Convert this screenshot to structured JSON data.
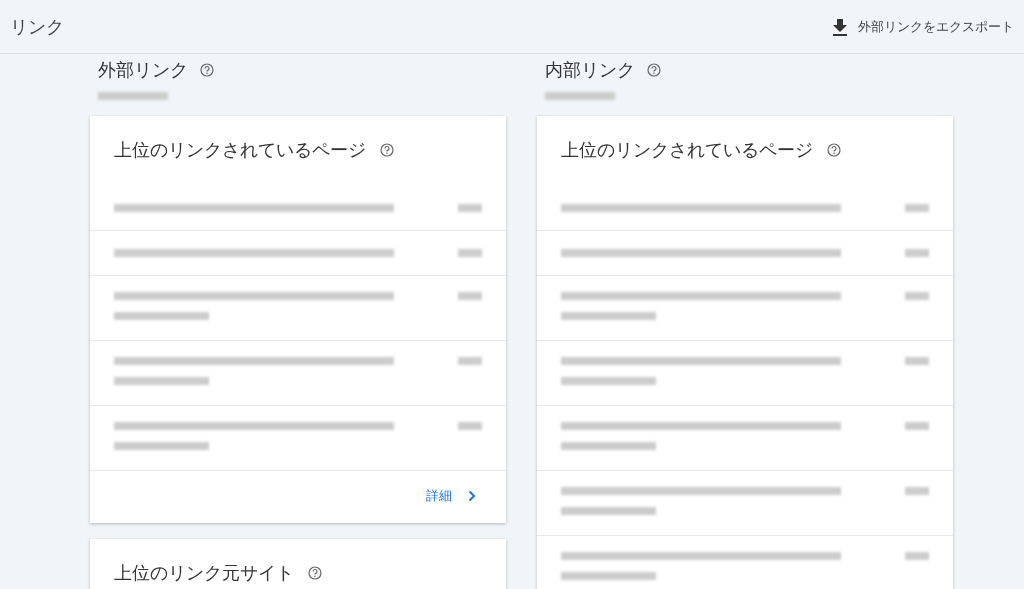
{
  "header": {
    "title": "リンク",
    "export_button": "外部リンクをエクスポート"
  },
  "columns": [
    {
      "title": "外部リンク",
      "cards": [
        {
          "title": "上位のリンクされているページ",
          "rows": [
            {
              "kind": "single"
            },
            {
              "kind": "single"
            },
            {
              "kind": "double"
            },
            {
              "kind": "double"
            },
            {
              "kind": "double"
            }
          ],
          "footer_link": "詳細"
        },
        {
          "title": "上位のリンク元サイト"
        }
      ]
    },
    {
      "title": "内部リンク",
      "cards": [
        {
          "title": "上位のリンクされているページ",
          "rows": [
            {
              "kind": "single"
            },
            {
              "kind": "single"
            },
            {
              "kind": "double"
            },
            {
              "kind": "double"
            },
            {
              "kind": "double"
            },
            {
              "kind": "double"
            },
            {
              "kind": "double"
            }
          ]
        }
      ]
    }
  ]
}
